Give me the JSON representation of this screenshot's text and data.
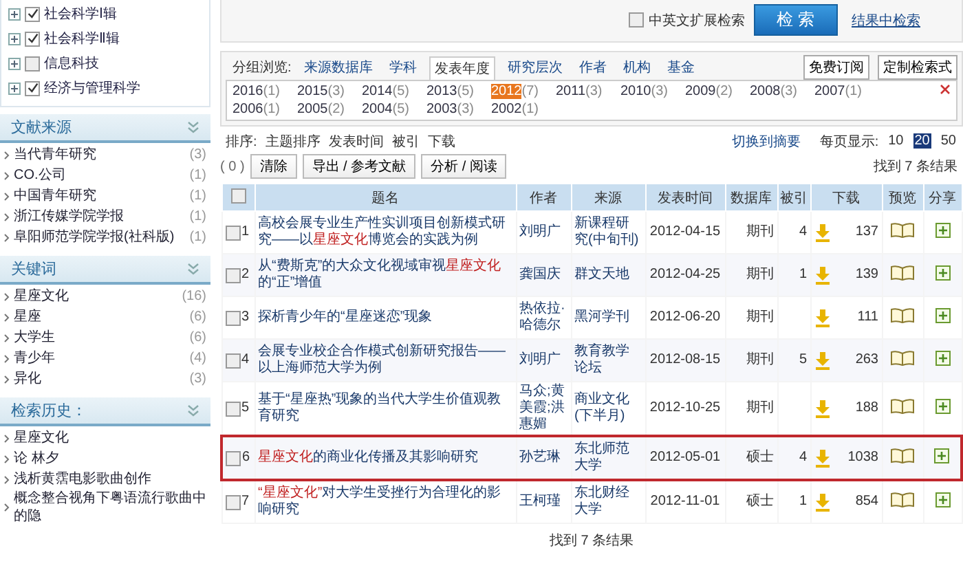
{
  "sidebar": {
    "subjects": [
      {
        "label": "社会科学Ⅰ辑",
        "checked": true
      },
      {
        "label": "社会科学Ⅱ辑",
        "checked": true
      },
      {
        "label": "信息科技",
        "checked": false
      },
      {
        "label": "经济与管理科学",
        "checked": true
      }
    ],
    "sections": [
      {
        "title": "文献来源",
        "items": [
          {
            "label": "当代青年研究",
            "count": "(3)"
          },
          {
            "label": "CO.公司",
            "count": "(1)"
          },
          {
            "label": "中国青年研究",
            "count": "(1)"
          },
          {
            "label": "浙江传媒学院学报",
            "count": "(1)"
          },
          {
            "label": "阜阳师范学院学报(社科版)",
            "count": "(1)"
          }
        ]
      },
      {
        "title": "关键词",
        "items": [
          {
            "label": "星座文化",
            "count": "(16)"
          },
          {
            "label": "星座",
            "count": "(6)"
          },
          {
            "label": "大学生",
            "count": "(6)"
          },
          {
            "label": "青少年",
            "count": "(4)"
          },
          {
            "label": "异化",
            "count": "(3)"
          }
        ]
      },
      {
        "title": "检索历史：",
        "items": [
          {
            "label": "星座文化"
          },
          {
            "label": "论 林夕"
          },
          {
            "label": "浅析黄霑电影歌曲创作"
          },
          {
            "label": "概念整合视角下粤语流行歌曲中的隐"
          }
        ]
      }
    ]
  },
  "search": {
    "extend_label": "中英文扩展检索",
    "extend_checked": false,
    "search_button": "检 索",
    "within_link": "结果中检索"
  },
  "grouping": {
    "label": "分组浏览:",
    "tabs": [
      {
        "label": "来源数据库",
        "selected": false
      },
      {
        "label": "学科",
        "selected": false
      },
      {
        "label": "发表年度",
        "selected": true
      },
      {
        "label": "研究层次",
        "selected": false
      },
      {
        "label": "作者",
        "selected": false
      },
      {
        "label": "机构",
        "selected": false
      },
      {
        "label": "基金",
        "selected": false
      }
    ],
    "buttons": [
      "免费订阅",
      "定制检索式"
    ],
    "years": [
      {
        "year": "2016",
        "count": "(1)",
        "selected": false
      },
      {
        "year": "2015",
        "count": "(3)",
        "selected": false
      },
      {
        "year": "2014",
        "count": "(5)",
        "selected": false
      },
      {
        "year": "2013",
        "count": "(5)",
        "selected": false
      },
      {
        "year": "2012",
        "count": "(7)",
        "selected": true
      },
      {
        "year": "2011",
        "count": "(3)",
        "selected": false
      },
      {
        "year": "2010",
        "count": "(3)",
        "selected": false
      },
      {
        "year": "2009",
        "count": "(2)",
        "selected": false
      },
      {
        "year": "2008",
        "count": "(3)",
        "selected": false
      },
      {
        "year": "2007",
        "count": "(1)",
        "selected": false
      },
      {
        "year": "2006",
        "count": "(1)",
        "selected": false
      },
      {
        "year": "2005",
        "count": "(2)",
        "selected": false
      },
      {
        "year": "2004",
        "count": "(5)",
        "selected": false
      },
      {
        "year": "2003",
        "count": "(3)",
        "selected": false
      },
      {
        "year": "2002",
        "count": "(1)",
        "selected": false
      }
    ]
  },
  "sort": {
    "label": "排序:",
    "options": [
      "主题排序",
      "发表时间",
      "被引",
      "下载"
    ],
    "switch_link": "切换到摘要",
    "per_page_label": "每页显示:",
    "per_page": [
      {
        "label": "10",
        "selected": false
      },
      {
        "label": "20",
        "selected": true
      },
      {
        "label": "50",
        "selected": false
      }
    ]
  },
  "actions": {
    "count": "( 0 )",
    "buttons": [
      "清除",
      "导出 / 参考文献",
      "分析 / 阅读"
    ],
    "found": "找到 7 条结果"
  },
  "table": {
    "all_checked": false,
    "columns": [
      "题名",
      "作者",
      "来源",
      "发表时间",
      "数据库",
      "被引",
      "下载",
      "预览",
      "分享"
    ],
    "rows": [
      {
        "no": "1",
        "checked": false,
        "selected": false,
        "title": [
          {
            "text": "高校会展专业生产性实训项目创新模式研究——以",
            "hl": false
          },
          {
            "text": "星座文化",
            "hl": true
          },
          {
            "text": "博览会的实践为例",
            "hl": false
          }
        ],
        "author": "刘明广",
        "source": "新课程研究(中旬刊)",
        "date": "2012-04-15",
        "db": "期刊",
        "cited": "4",
        "downloads": "137"
      },
      {
        "no": "2",
        "checked": false,
        "selected": false,
        "title": [
          {
            "text": "从“费斯克”的大众文化视域审视",
            "hl": false
          },
          {
            "text": "星座文化",
            "hl": true
          },
          {
            "text": "的“正”增值",
            "hl": false
          }
        ],
        "author": "龚国庆",
        "source": "群文天地",
        "date": "2012-04-25",
        "db": "期刊",
        "cited": "1",
        "downloads": "139"
      },
      {
        "no": "3",
        "checked": false,
        "selected": false,
        "title": [
          {
            "text": "探析青少年的“星座迷恋”现象",
            "hl": false
          }
        ],
        "author": "热依拉·哈德尔",
        "source": "黑河学刊",
        "date": "2012-06-20",
        "db": "期刊",
        "cited": "",
        "downloads": "111"
      },
      {
        "no": "4",
        "checked": false,
        "selected": false,
        "title": [
          {
            "text": "会展专业校企合作模式创新研究报告——以上海师范大学为例",
            "hl": false
          }
        ],
        "author": "刘明广",
        "source": "教育教学论坛",
        "date": "2012-08-15",
        "db": "期刊",
        "cited": "5",
        "downloads": "263"
      },
      {
        "no": "5",
        "checked": false,
        "selected": false,
        "title": [
          {
            "text": "基于“星座热”现象的当代大学生价值观教育研究",
            "hl": false
          }
        ],
        "author": "马众;黄美霞;洪惠媚",
        "source": "商业文化(下半月)",
        "date": "2012-10-25",
        "db": "期刊",
        "cited": "",
        "downloads": "188"
      },
      {
        "no": "6",
        "checked": false,
        "selected": true,
        "title": [
          {
            "text": "星座文化",
            "hl": true
          },
          {
            "text": "的商业化传播及其影响研究",
            "hl": false
          }
        ],
        "author": "孙艺琳",
        "source": "东北师范大学",
        "date": "2012-05-01",
        "db": "硕士",
        "cited": "4",
        "downloads": "1038"
      },
      {
        "no": "7",
        "checked": false,
        "selected": false,
        "title": [
          {
            "text": "“星座文化”",
            "hl": true
          },
          {
            "text": "对大学生受挫行为合理化的影响研究",
            "hl": false
          }
        ],
        "author": "王柯瑾",
        "source": "东北财经大学",
        "date": "2012-11-01",
        "db": "硕士",
        "cited": "1",
        "downloads": "854"
      }
    ]
  },
  "footer": "找到 7 条结果"
}
